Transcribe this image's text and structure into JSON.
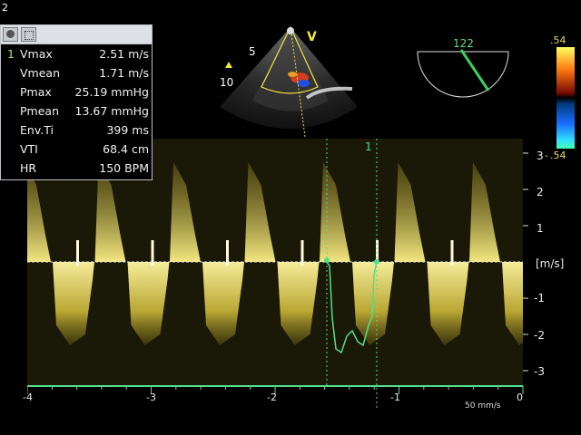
{
  "header": {
    "screen_number": "2"
  },
  "probe": {
    "angle_label": "V",
    "depth_5": "5",
    "depth_10": "10",
    "orientation_icon": "triangle-marker-icon"
  },
  "angle_indicator": {
    "value": "122"
  },
  "color_scale": {
    "top": ".54",
    "bottom": ".54"
  },
  "measurement_panel": {
    "toolbar_icons": [
      "circle-tool-icon",
      "caliper-tool-icon"
    ],
    "index": "1",
    "rows": [
      {
        "label": "Vmax",
        "value": "2.51 m/s"
      },
      {
        "label": "Vmean",
        "value": "1.71 m/s"
      },
      {
        "label": "Pmax",
        "value": "25.19 mmHg"
      },
      {
        "label": "Pmean",
        "value": "13.67 mmHg"
      },
      {
        "label": "Env.Ti",
        "value": "399 ms"
      },
      {
        "label": "VTI",
        "value": "68.4 cm"
      },
      {
        "label": "HR",
        "value": "150 BPM"
      }
    ]
  },
  "doppler": {
    "cursor_label": "1",
    "velocity_ticks": [
      "3",
      "2",
      "1",
      "-1",
      "-2",
      "-3"
    ],
    "unit_label": "[m/s]",
    "time_ticks": [
      "-4",
      "-3",
      "-2",
      "-1",
      "0"
    ],
    "sweep_speed": "50 mm/s",
    "colors": {
      "signal": "#c8b53a",
      "trace": "#52e08a",
      "baseline": "#9fe8b0"
    }
  }
}
